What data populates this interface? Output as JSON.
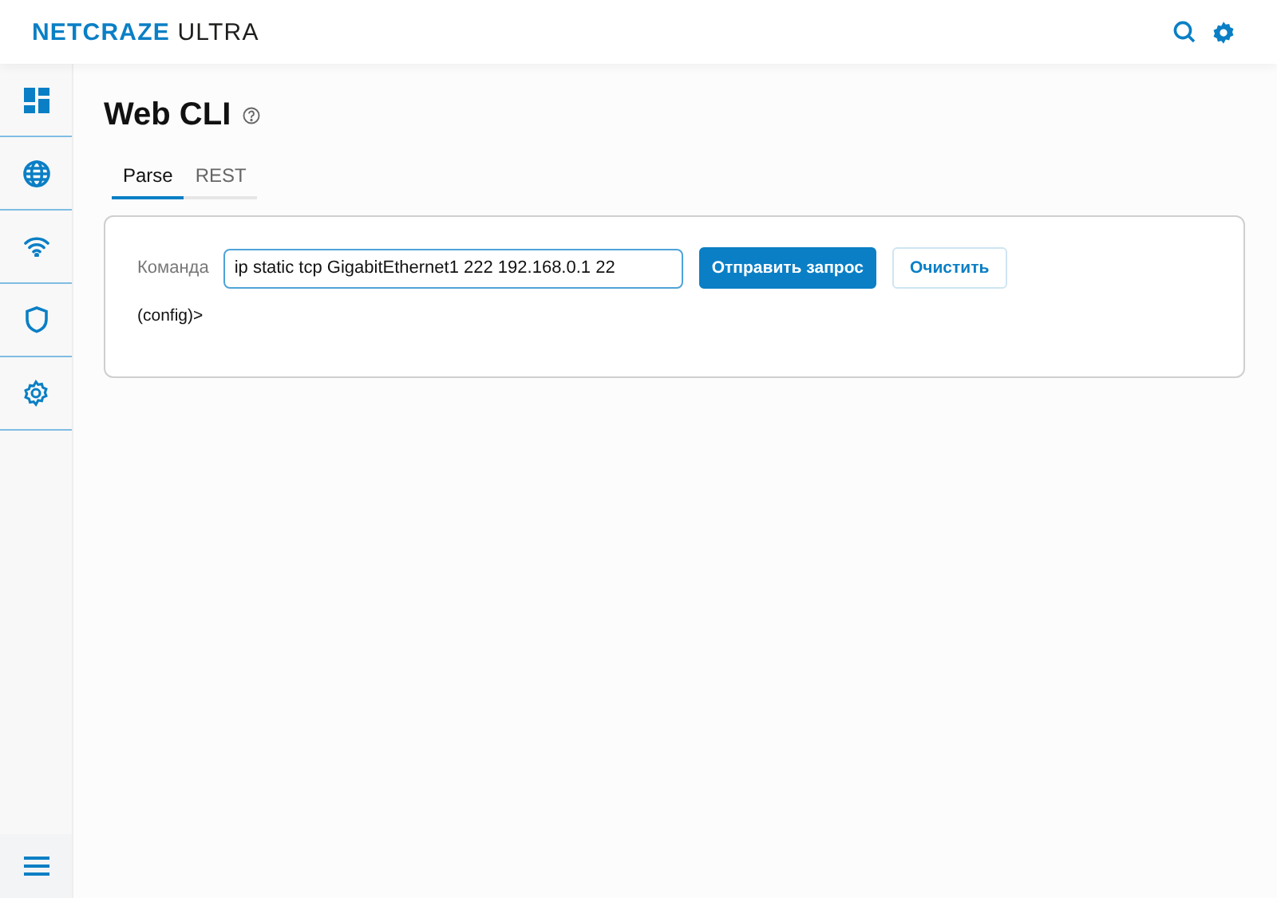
{
  "header": {
    "logo": {
      "brand": "NETCRAZE",
      "product": "ULTRA"
    }
  },
  "sidebar": {
    "items": [
      {
        "kind": "dashboard"
      },
      {
        "kind": "globe"
      },
      {
        "kind": "wifi"
      },
      {
        "kind": "shield"
      },
      {
        "kind": "gear"
      }
    ],
    "footer": {
      "kind": "menu"
    }
  },
  "page": {
    "title": "Web CLI",
    "tabs": [
      {
        "label": "Parse",
        "selected": true
      },
      {
        "label": "REST",
        "selected": false
      }
    ],
    "command": {
      "label": "Команда",
      "value": "ip static tcp GigabitEthernet1 222 192.168.0.1 22"
    },
    "buttons": [
      {
        "label": "Отправить запрос",
        "kind": "primary"
      },
      {
        "label": "Очистить",
        "kind": "secondary"
      }
    ],
    "output": "(config)>"
  }
}
